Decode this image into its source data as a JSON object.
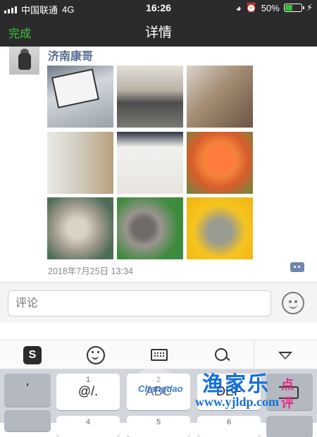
{
  "status_bar": {
    "carrier": "中国联通",
    "network": "4G",
    "time": "16:26",
    "battery": "50%",
    "battery_level": 0.5
  },
  "nav": {
    "done_label": "完成",
    "title": "详情"
  },
  "post": {
    "username": "济南康哥",
    "timestamp": "2018年7月25日 13:34",
    "photo_count": 9
  },
  "comment": {
    "placeholder": "评论"
  },
  "keyboard": {
    "keys": [
      {
        "num": "",
        "label": ","
      },
      {
        "num": "1",
        "label": "@/."
      },
      {
        "num": "2",
        "label": "ABC"
      },
      {
        "num": "3",
        "label": "DEF"
      },
      {
        "num": "4",
        "label": ""
      },
      {
        "num": "5",
        "label": ""
      },
      {
        "num": "6",
        "label": ""
      }
    ]
  },
  "watermark": {
    "logo_text": "Changdao",
    "chinese": "渔家乐",
    "small": "点评",
    "url": "www.yjldp.com"
  },
  "colors": {
    "nav_bg": "#2b2b2b",
    "done_green": "#3ec53e",
    "username_blue": "#566b94"
  }
}
